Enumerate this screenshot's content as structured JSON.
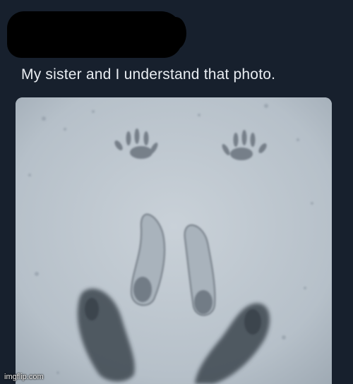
{
  "post": {
    "author_redacted": true,
    "caption": "My sister and I understand that photo.",
    "image_description_icon": "handprints-footprints-in-snow"
  },
  "watermark": {
    "text": "imgflip.com"
  },
  "colors": {
    "background": "#17202d",
    "caption": "#e9edf2",
    "snow": "#b9c3cb",
    "prints": "#3e4650"
  }
}
